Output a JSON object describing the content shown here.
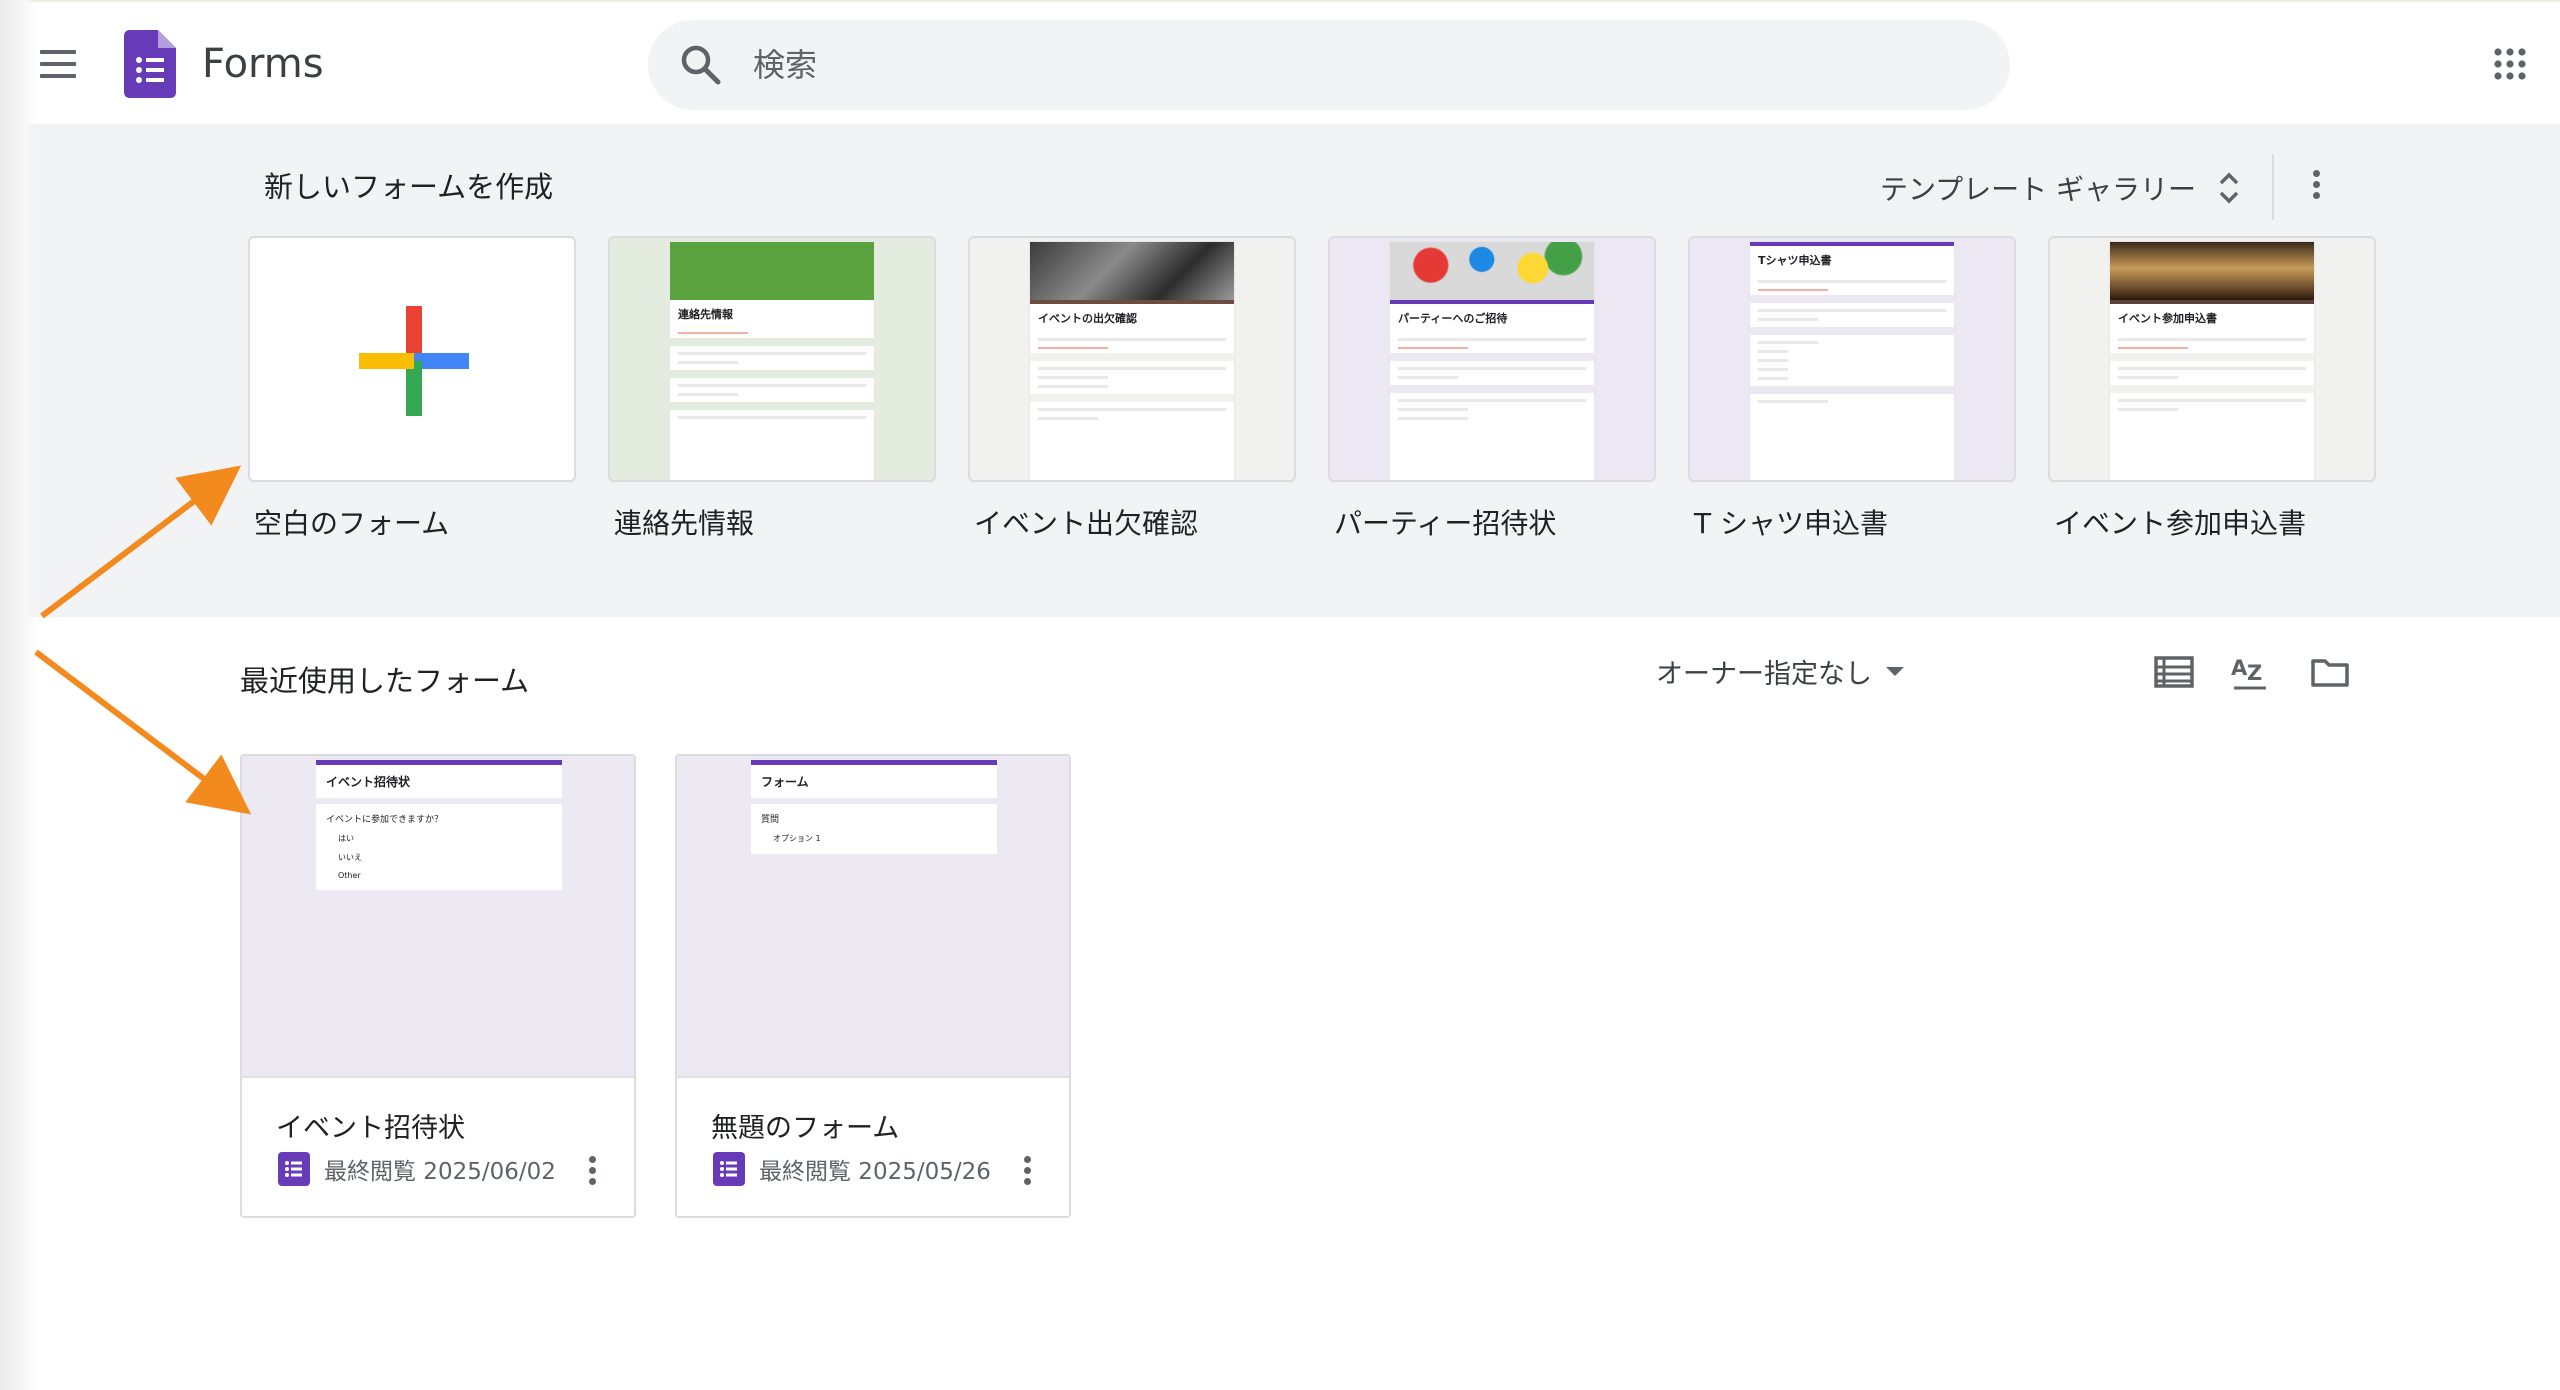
{
  "app": {
    "title": "Forms"
  },
  "search": {
    "placeholder": "検索"
  },
  "templates": {
    "heading": "新しいフォームを作成",
    "gallery_label": "テンプレート ギャラリー",
    "items": [
      {
        "label": "空白のフォーム"
      },
      {
        "label": "連絡先情報",
        "preview_title": "連絡先情報"
      },
      {
        "label": "イベント出欠確認",
        "preview_title": "イベントの出欠確認"
      },
      {
        "label": "パーティー招待状",
        "preview_title": "パーティーへのご招待"
      },
      {
        "label": "T シャツ申込書",
        "preview_title": "Tシャツ申込書"
      },
      {
        "label": "イベント参加申込書",
        "preview_title": "イベント参加申込書"
      }
    ]
  },
  "recent": {
    "heading": "最近使用したフォーム",
    "owner_filter": "オーナー指定なし",
    "forms": [
      {
        "title": "イベント招待状",
        "meta": "最終閲覧 2025/06/02",
        "preview_title": "イベント招待状",
        "preview_question": "イベントに参加できますか？",
        "preview_options": [
          "はい",
          "いいえ",
          "Other"
        ]
      },
      {
        "title": "無題のフォーム",
        "meta": "最終閲覧 2025/05/26",
        "preview_title": "フォーム",
        "preview_question": "質問",
        "preview_options": [
          "オプション 1"
        ]
      }
    ]
  },
  "colors": {
    "accent": "#673ab7",
    "plus_red": "#ea4335",
    "plus_blue": "#4285f4",
    "plus_green": "#34a853",
    "plus_yellow": "#fbbc04",
    "arrow": "#f28a1e"
  }
}
